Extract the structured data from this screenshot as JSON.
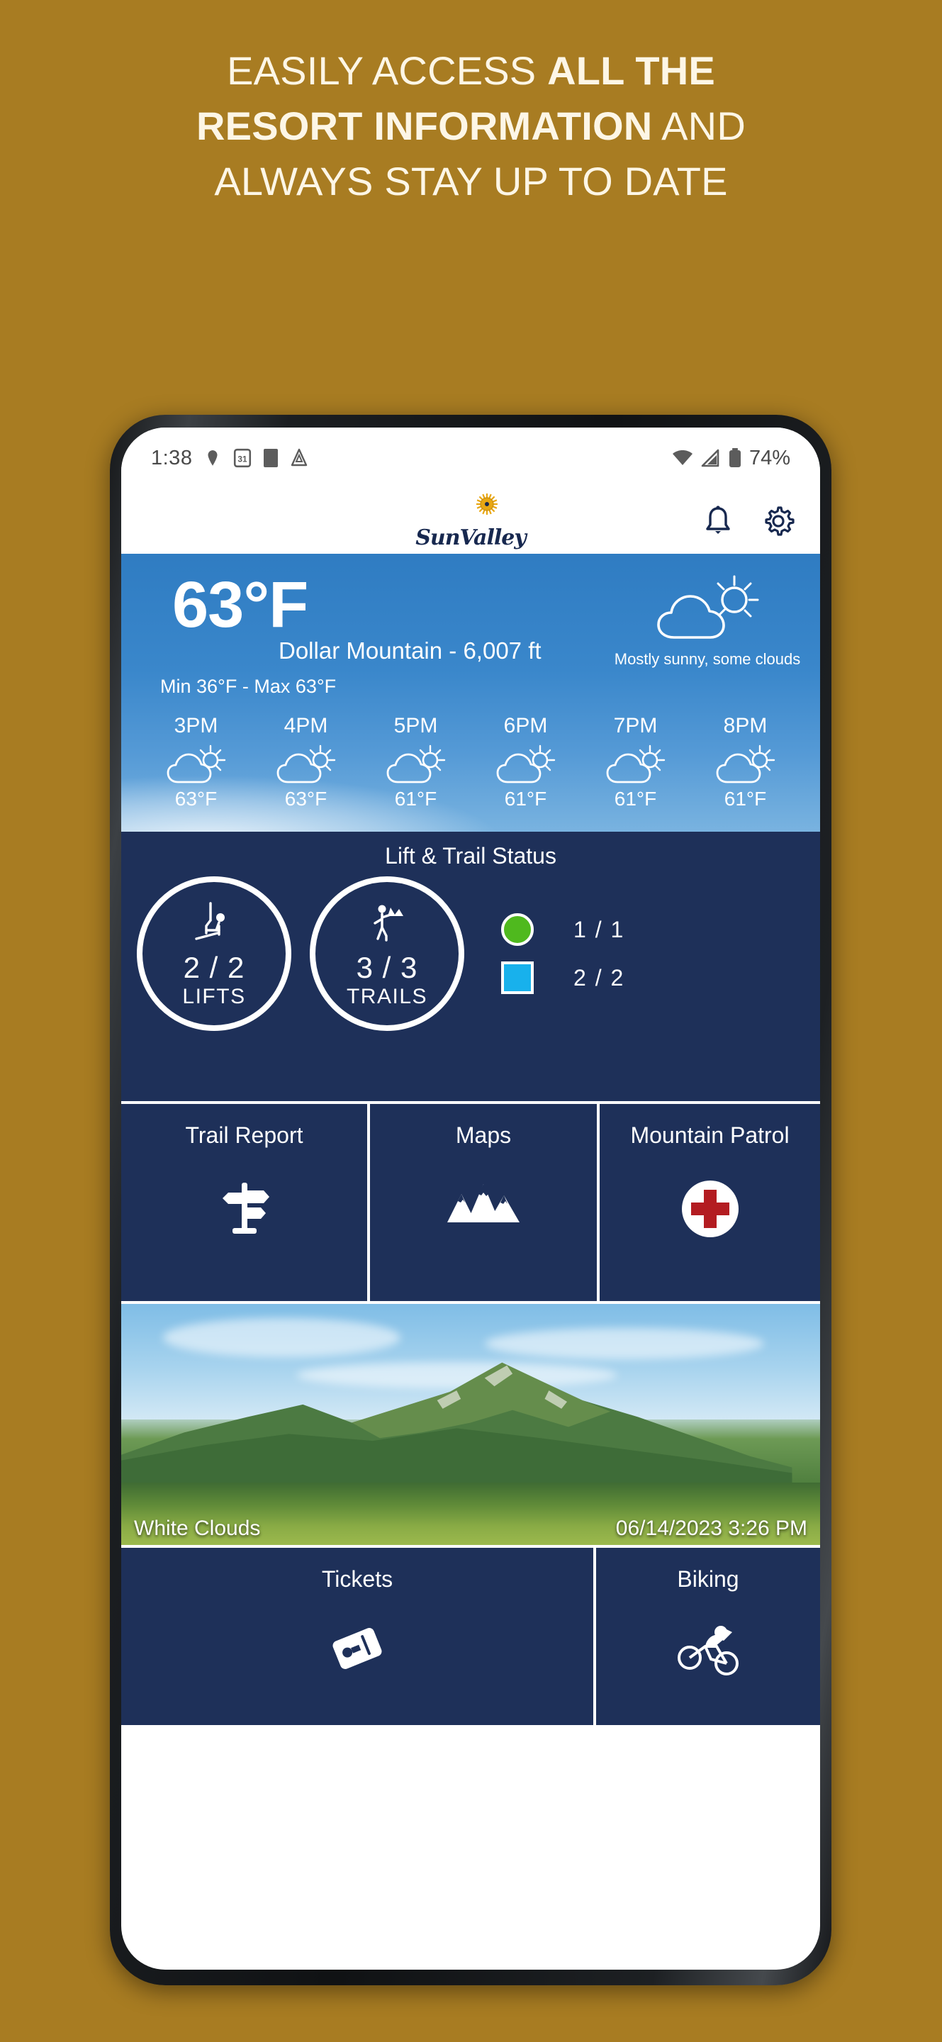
{
  "promo": {
    "line1_plain": "EASILY ACCESS ",
    "line1_bold": "ALL THE",
    "line2_bold": "RESORT INFORMATION",
    "line2_plain": " AND",
    "line3": "ALWAYS STAY UP TO DATE",
    "background_color": "#a87c22",
    "text_color": "#fdf6e6"
  },
  "status_bar": {
    "time": "1:38",
    "battery": "74%",
    "icons": [
      "location-icon",
      "calendar-icon",
      "app-icon",
      "drive-icon",
      "wifi-icon",
      "signal-icon",
      "battery-icon"
    ]
  },
  "app_header": {
    "brand": "SunValley",
    "sun_color": "#e8a713",
    "brand_color": "#17284f",
    "actions": [
      "notification-bell-icon",
      "settings-gear-icon"
    ]
  },
  "weather": {
    "temperature": "63°F",
    "location": "Dollar Mountain - 6,007 ft",
    "min_max": "Min 36°F - Max 63°F",
    "condition": "Mostly sunny, some clouds",
    "panel_color": "#3a87cb",
    "hourly": [
      {
        "time": "3PM",
        "temp": "63°F",
        "icon": "partly-cloudy-icon"
      },
      {
        "time": "4PM",
        "temp": "63°F",
        "icon": "partly-cloudy-icon"
      },
      {
        "time": "5PM",
        "temp": "61°F",
        "icon": "partly-cloudy-icon"
      },
      {
        "time": "6PM",
        "temp": "61°F",
        "icon": "partly-cloudy-icon"
      },
      {
        "time": "7PM",
        "temp": "61°F",
        "icon": "partly-cloudy-icon"
      },
      {
        "time": "8PM",
        "temp": "61°F",
        "icon": "partly-cloudy-icon"
      }
    ]
  },
  "lift_trail": {
    "title": "Lift & Trail Status",
    "lifts": {
      "count": "2 / 2",
      "label": "LIFTS",
      "icon": "chairlift-icon"
    },
    "trails": {
      "count": "3 / 3",
      "label": "TRAILS",
      "icon": "hiker-icon"
    },
    "legend": [
      {
        "shape": "green-circle",
        "count": "1 / 1",
        "color": "#4fb91e"
      },
      {
        "shape": "blue-square",
        "count": "2 / 2",
        "color": "#18b1ec"
      }
    ],
    "panel_color": "#1e3059"
  },
  "tiles_row_1": [
    {
      "label": "Trail Report",
      "icon": "signpost-icon"
    },
    {
      "label": "Maps",
      "icon": "mountains-icon"
    },
    {
      "label": "Mountain Patrol",
      "icon": "medical-cross-icon"
    }
  ],
  "webcam": {
    "name": "White Clouds",
    "timestamp": "06/14/2023 3:26 PM"
  },
  "tiles_row_2": [
    {
      "label": "Tickets",
      "icon": "ticket-icon"
    },
    {
      "label": "Biking",
      "icon": "cyclist-icon"
    }
  ]
}
